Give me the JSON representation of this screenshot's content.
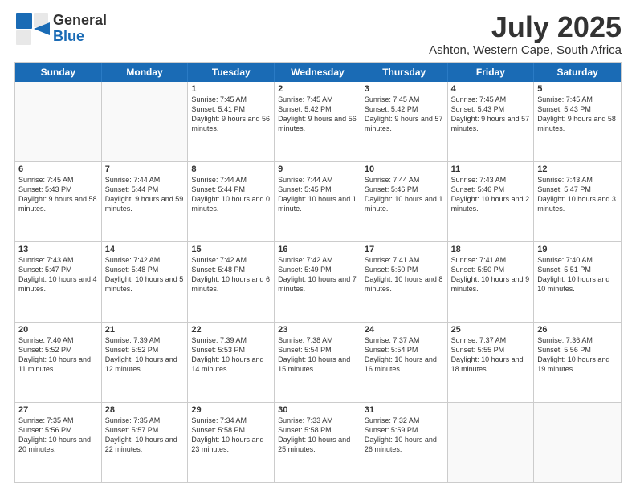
{
  "header": {
    "logo_line1": "General",
    "logo_line2": "Blue",
    "title": "July 2025",
    "subtitle": "Ashton, Western Cape, South Africa"
  },
  "days_of_week": [
    "Sunday",
    "Monday",
    "Tuesday",
    "Wednesday",
    "Thursday",
    "Friday",
    "Saturday"
  ],
  "weeks": [
    [
      {
        "day": "",
        "info": "",
        "empty": true
      },
      {
        "day": "",
        "info": "",
        "empty": true
      },
      {
        "day": "1",
        "info": "Sunrise: 7:45 AM\nSunset: 5:41 PM\nDaylight: 9 hours and 56 minutes.",
        "empty": false
      },
      {
        "day": "2",
        "info": "Sunrise: 7:45 AM\nSunset: 5:42 PM\nDaylight: 9 hours and 56 minutes.",
        "empty": false
      },
      {
        "day": "3",
        "info": "Sunrise: 7:45 AM\nSunset: 5:42 PM\nDaylight: 9 hours and 57 minutes.",
        "empty": false
      },
      {
        "day": "4",
        "info": "Sunrise: 7:45 AM\nSunset: 5:43 PM\nDaylight: 9 hours and 57 minutes.",
        "empty": false
      },
      {
        "day": "5",
        "info": "Sunrise: 7:45 AM\nSunset: 5:43 PM\nDaylight: 9 hours and 58 minutes.",
        "empty": false
      }
    ],
    [
      {
        "day": "6",
        "info": "Sunrise: 7:45 AM\nSunset: 5:43 PM\nDaylight: 9 hours and 58 minutes.",
        "empty": false
      },
      {
        "day": "7",
        "info": "Sunrise: 7:44 AM\nSunset: 5:44 PM\nDaylight: 9 hours and 59 minutes.",
        "empty": false
      },
      {
        "day": "8",
        "info": "Sunrise: 7:44 AM\nSunset: 5:44 PM\nDaylight: 10 hours and 0 minutes.",
        "empty": false
      },
      {
        "day": "9",
        "info": "Sunrise: 7:44 AM\nSunset: 5:45 PM\nDaylight: 10 hours and 1 minute.",
        "empty": false
      },
      {
        "day": "10",
        "info": "Sunrise: 7:44 AM\nSunset: 5:46 PM\nDaylight: 10 hours and 1 minute.",
        "empty": false
      },
      {
        "day": "11",
        "info": "Sunrise: 7:43 AM\nSunset: 5:46 PM\nDaylight: 10 hours and 2 minutes.",
        "empty": false
      },
      {
        "day": "12",
        "info": "Sunrise: 7:43 AM\nSunset: 5:47 PM\nDaylight: 10 hours and 3 minutes.",
        "empty": false
      }
    ],
    [
      {
        "day": "13",
        "info": "Sunrise: 7:43 AM\nSunset: 5:47 PM\nDaylight: 10 hours and 4 minutes.",
        "empty": false
      },
      {
        "day": "14",
        "info": "Sunrise: 7:42 AM\nSunset: 5:48 PM\nDaylight: 10 hours and 5 minutes.",
        "empty": false
      },
      {
        "day": "15",
        "info": "Sunrise: 7:42 AM\nSunset: 5:48 PM\nDaylight: 10 hours and 6 minutes.",
        "empty": false
      },
      {
        "day": "16",
        "info": "Sunrise: 7:42 AM\nSunset: 5:49 PM\nDaylight: 10 hours and 7 minutes.",
        "empty": false
      },
      {
        "day": "17",
        "info": "Sunrise: 7:41 AM\nSunset: 5:50 PM\nDaylight: 10 hours and 8 minutes.",
        "empty": false
      },
      {
        "day": "18",
        "info": "Sunrise: 7:41 AM\nSunset: 5:50 PM\nDaylight: 10 hours and 9 minutes.",
        "empty": false
      },
      {
        "day": "19",
        "info": "Sunrise: 7:40 AM\nSunset: 5:51 PM\nDaylight: 10 hours and 10 minutes.",
        "empty": false
      }
    ],
    [
      {
        "day": "20",
        "info": "Sunrise: 7:40 AM\nSunset: 5:52 PM\nDaylight: 10 hours and 11 minutes.",
        "empty": false
      },
      {
        "day": "21",
        "info": "Sunrise: 7:39 AM\nSunset: 5:52 PM\nDaylight: 10 hours and 12 minutes.",
        "empty": false
      },
      {
        "day": "22",
        "info": "Sunrise: 7:39 AM\nSunset: 5:53 PM\nDaylight: 10 hours and 14 minutes.",
        "empty": false
      },
      {
        "day": "23",
        "info": "Sunrise: 7:38 AM\nSunset: 5:54 PM\nDaylight: 10 hours and 15 minutes.",
        "empty": false
      },
      {
        "day": "24",
        "info": "Sunrise: 7:37 AM\nSunset: 5:54 PM\nDaylight: 10 hours and 16 minutes.",
        "empty": false
      },
      {
        "day": "25",
        "info": "Sunrise: 7:37 AM\nSunset: 5:55 PM\nDaylight: 10 hours and 18 minutes.",
        "empty": false
      },
      {
        "day": "26",
        "info": "Sunrise: 7:36 AM\nSunset: 5:56 PM\nDaylight: 10 hours and 19 minutes.",
        "empty": false
      }
    ],
    [
      {
        "day": "27",
        "info": "Sunrise: 7:35 AM\nSunset: 5:56 PM\nDaylight: 10 hours and 20 minutes.",
        "empty": false
      },
      {
        "day": "28",
        "info": "Sunrise: 7:35 AM\nSunset: 5:57 PM\nDaylight: 10 hours and 22 minutes.",
        "empty": false
      },
      {
        "day": "29",
        "info": "Sunrise: 7:34 AM\nSunset: 5:58 PM\nDaylight: 10 hours and 23 minutes.",
        "empty": false
      },
      {
        "day": "30",
        "info": "Sunrise: 7:33 AM\nSunset: 5:58 PM\nDaylight: 10 hours and 25 minutes.",
        "empty": false
      },
      {
        "day": "31",
        "info": "Sunrise: 7:32 AM\nSunset: 5:59 PM\nDaylight: 10 hours and 26 minutes.",
        "empty": false
      },
      {
        "day": "",
        "info": "",
        "empty": true
      },
      {
        "day": "",
        "info": "",
        "empty": true
      }
    ]
  ]
}
